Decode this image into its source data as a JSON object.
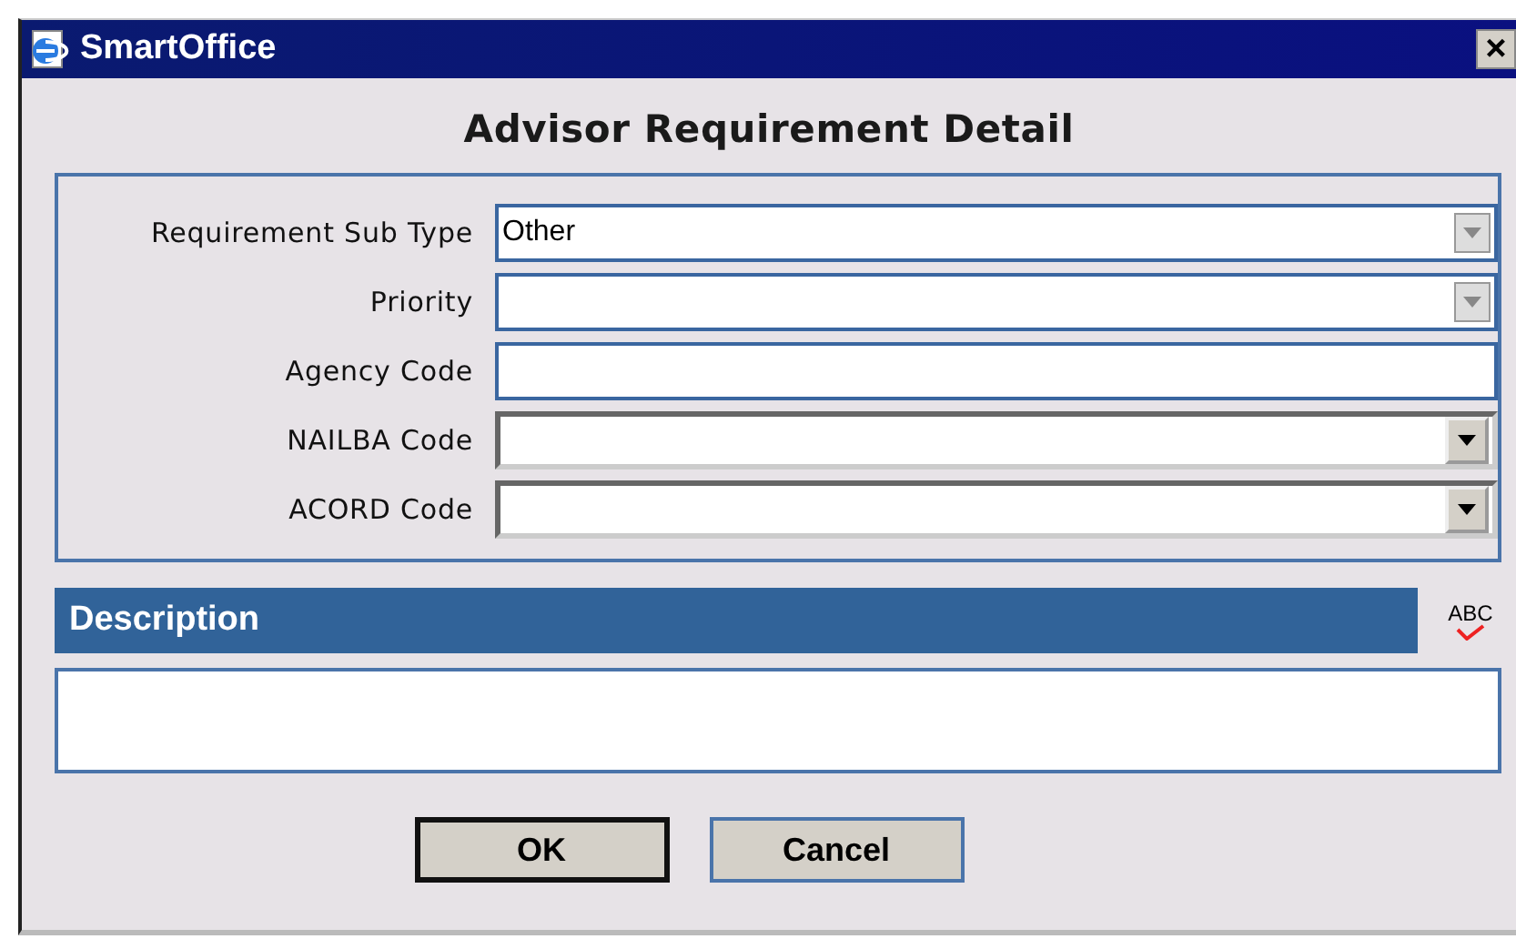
{
  "window": {
    "title": "SmartOffice",
    "close": "×"
  },
  "heading": "Advisor Requirement Detail",
  "fields": [
    {
      "label": "Requirement Sub Type",
      "kind": "flat-select",
      "value": "Other"
    },
    {
      "label": "Priority",
      "kind": "flat-select"
    },
    {
      "label": "Agency Code",
      "kind": "text"
    },
    {
      "label": "NAILBA Code",
      "kind": "sunken-select"
    },
    {
      "label": "ACORD Code",
      "kind": "sunken-select"
    }
  ],
  "description": {
    "title": "Description",
    "spellcheck": "ABC"
  },
  "buttons": [
    {
      "label": "OK",
      "default": true
    },
    {
      "label": "Cancel",
      "default": false
    }
  ]
}
